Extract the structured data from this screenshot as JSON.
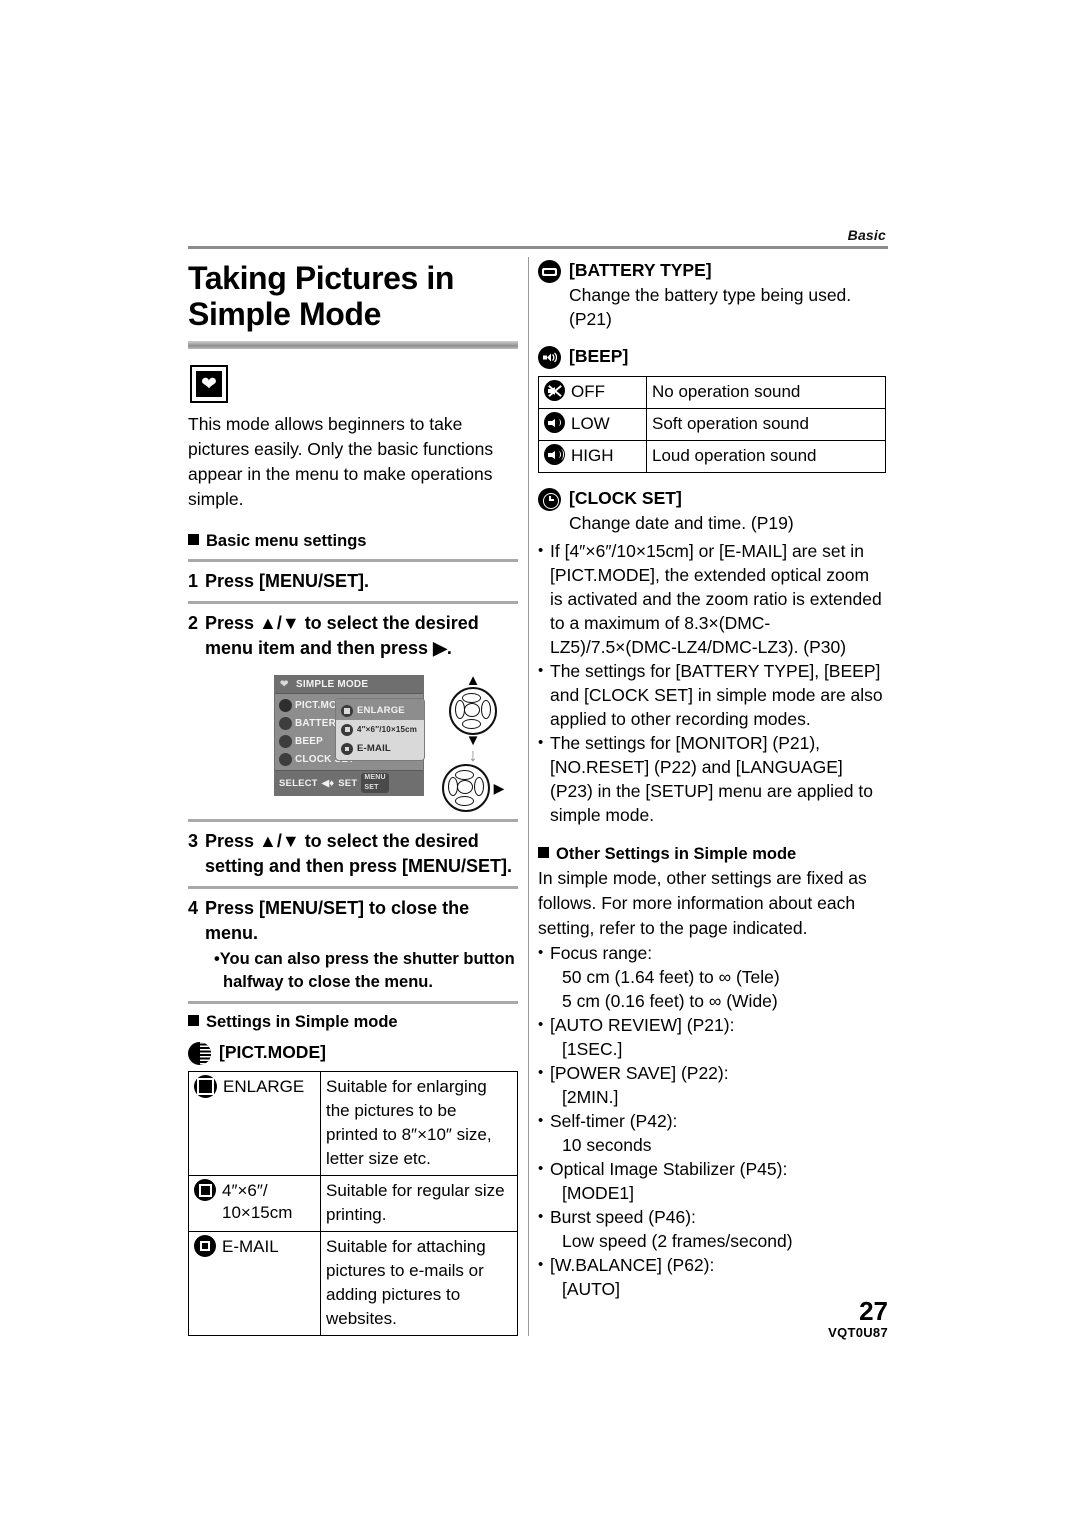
{
  "running_head": "Basic",
  "title": "Taking Pictures in Simple Mode",
  "mode_icon": "heart-icon",
  "intro": "This mode allows beginners to take pictures easily. Only the basic functions appear in the menu to make operations simple.",
  "basic_menu_heading": "Basic menu settings",
  "steps": [
    {
      "num": "1",
      "text": "Press [MENU/SET]."
    },
    {
      "num": "2",
      "text": "Press ▲/▼ to select the desired menu item and then press ▶."
    },
    {
      "num": "3",
      "text": "Press ▲/▼ to select the desired setting and then press [MENU/SET]."
    },
    {
      "num": "4",
      "text": "Press [MENU/SET] to close the menu."
    }
  ],
  "step4_note": "You can also press the shutter button halfway to close the menu.",
  "lcd": {
    "title": "SIMPLE MODE",
    "items": [
      {
        "label": "PICT.MODE",
        "icon": "pictmode-icon",
        "selected": true
      },
      {
        "label": "BATTERY TYP",
        "icon": "battery-icon",
        "selected": false
      },
      {
        "label": "BEEP",
        "icon": "beep-icon",
        "selected": false
      },
      {
        "label": "CLOCK SET",
        "icon": "clock-icon",
        "selected": false
      }
    ],
    "submenu": [
      {
        "label": "ENLARGE",
        "icon": "size-large-icon",
        "selected": true
      },
      {
        "label": "4″×6″/10×15cm",
        "icon": "size-mid-icon",
        "selected": false
      },
      {
        "label": "E-MAIL",
        "icon": "size-small-icon",
        "selected": false
      }
    ],
    "footer_select": "SELECT",
    "footer_select_glyph": "◀♦",
    "footer_set": "SET",
    "footer_set_button": "MENU\nSET"
  },
  "cursor_pad": {
    "up_glyph": "▲",
    "down_glyph": "▼",
    "move_glyph": "↓",
    "right_glyph": "▶"
  },
  "settings_heading": "Settings in Simple mode",
  "pictmode": {
    "heading": "[PICT.MODE]",
    "icon": "pictmode-icon",
    "rows": [
      {
        "icon": "size-large-icon",
        "label": "ENLARGE",
        "desc": "Suitable for enlarging the pictures to be printed to 8″×10″ size, letter size etc."
      },
      {
        "icon": "size-mid-icon",
        "label": "4″×6″/\n10×15cm",
        "label_line1": "4″×6″/",
        "label_line2": "10×15cm",
        "desc": "Suitable for regular size printing."
      },
      {
        "icon": "size-small-icon",
        "label": "E-MAIL",
        "desc": "Suitable for attaching pictures to e-mails or adding pictures to websites."
      }
    ]
  },
  "battery_type": {
    "heading": "[BATTERY TYPE]",
    "icon": "battery-icon",
    "body": "Change the battery type being used. (P21)"
  },
  "beep": {
    "heading": "[BEEP]",
    "icon": "beep-icon",
    "rows": [
      {
        "icon": "speaker-off-icon",
        "label": "OFF",
        "desc": "No operation sound"
      },
      {
        "icon": "speaker-low-icon",
        "label": "LOW",
        "desc": "Soft operation sound"
      },
      {
        "icon": "speaker-high-icon",
        "label": "HIGH",
        "desc": "Loud operation sound"
      }
    ]
  },
  "clock_set": {
    "heading": "[CLOCK SET]",
    "icon": "clock-icon",
    "body": "Change date and time. (P19)"
  },
  "notes": [
    "If [4″×6″/10×15cm] or [E-MAIL] are set in [PICT.MODE], the extended optical zoom is activated and the zoom ratio is extended to a maximum of 8.3×(DMC-LZ5)/7.5×(DMC-LZ4/DMC-LZ3). (P30)",
    "The settings for [BATTERY TYPE], [BEEP] and [CLOCK SET] in simple mode are also applied to other recording modes.",
    "The settings for [MONITOR] (P21), [NO.RESET] (P22) and [LANGUAGE] (P23) in the [SETUP] menu are applied to simple mode."
  ],
  "other_settings": {
    "heading": "Other Settings in Simple mode",
    "intro": "In simple mode, other settings are fixed as follows. For more information about each setting, refer to the page indicated.",
    "items": [
      {
        "label": "Focus range:",
        "values": [
          "50 cm (1.64 feet) to ∞ (Tele)",
          "5 cm (0.16 feet) to ∞ (Wide)"
        ]
      },
      {
        "label": "[AUTO REVIEW] (P21):",
        "values": [
          "[1SEC.]"
        ]
      },
      {
        "label": "[POWER SAVE] (P22):",
        "values": [
          "[2MIN.]"
        ]
      },
      {
        "label": "Self-timer (P42):",
        "values": [
          "10 seconds"
        ]
      },
      {
        "label": "Optical Image Stabilizer (P45):",
        "values": [
          "[MODE1]"
        ]
      },
      {
        "label": "Burst speed (P46):",
        "values": [
          "Low speed (2 frames/second)"
        ]
      },
      {
        "label": "[W.BALANCE] (P62):",
        "values": [
          "[AUTO]"
        ]
      }
    ]
  },
  "footer": {
    "page_number": "27",
    "doc_code": "VQT0U87"
  }
}
